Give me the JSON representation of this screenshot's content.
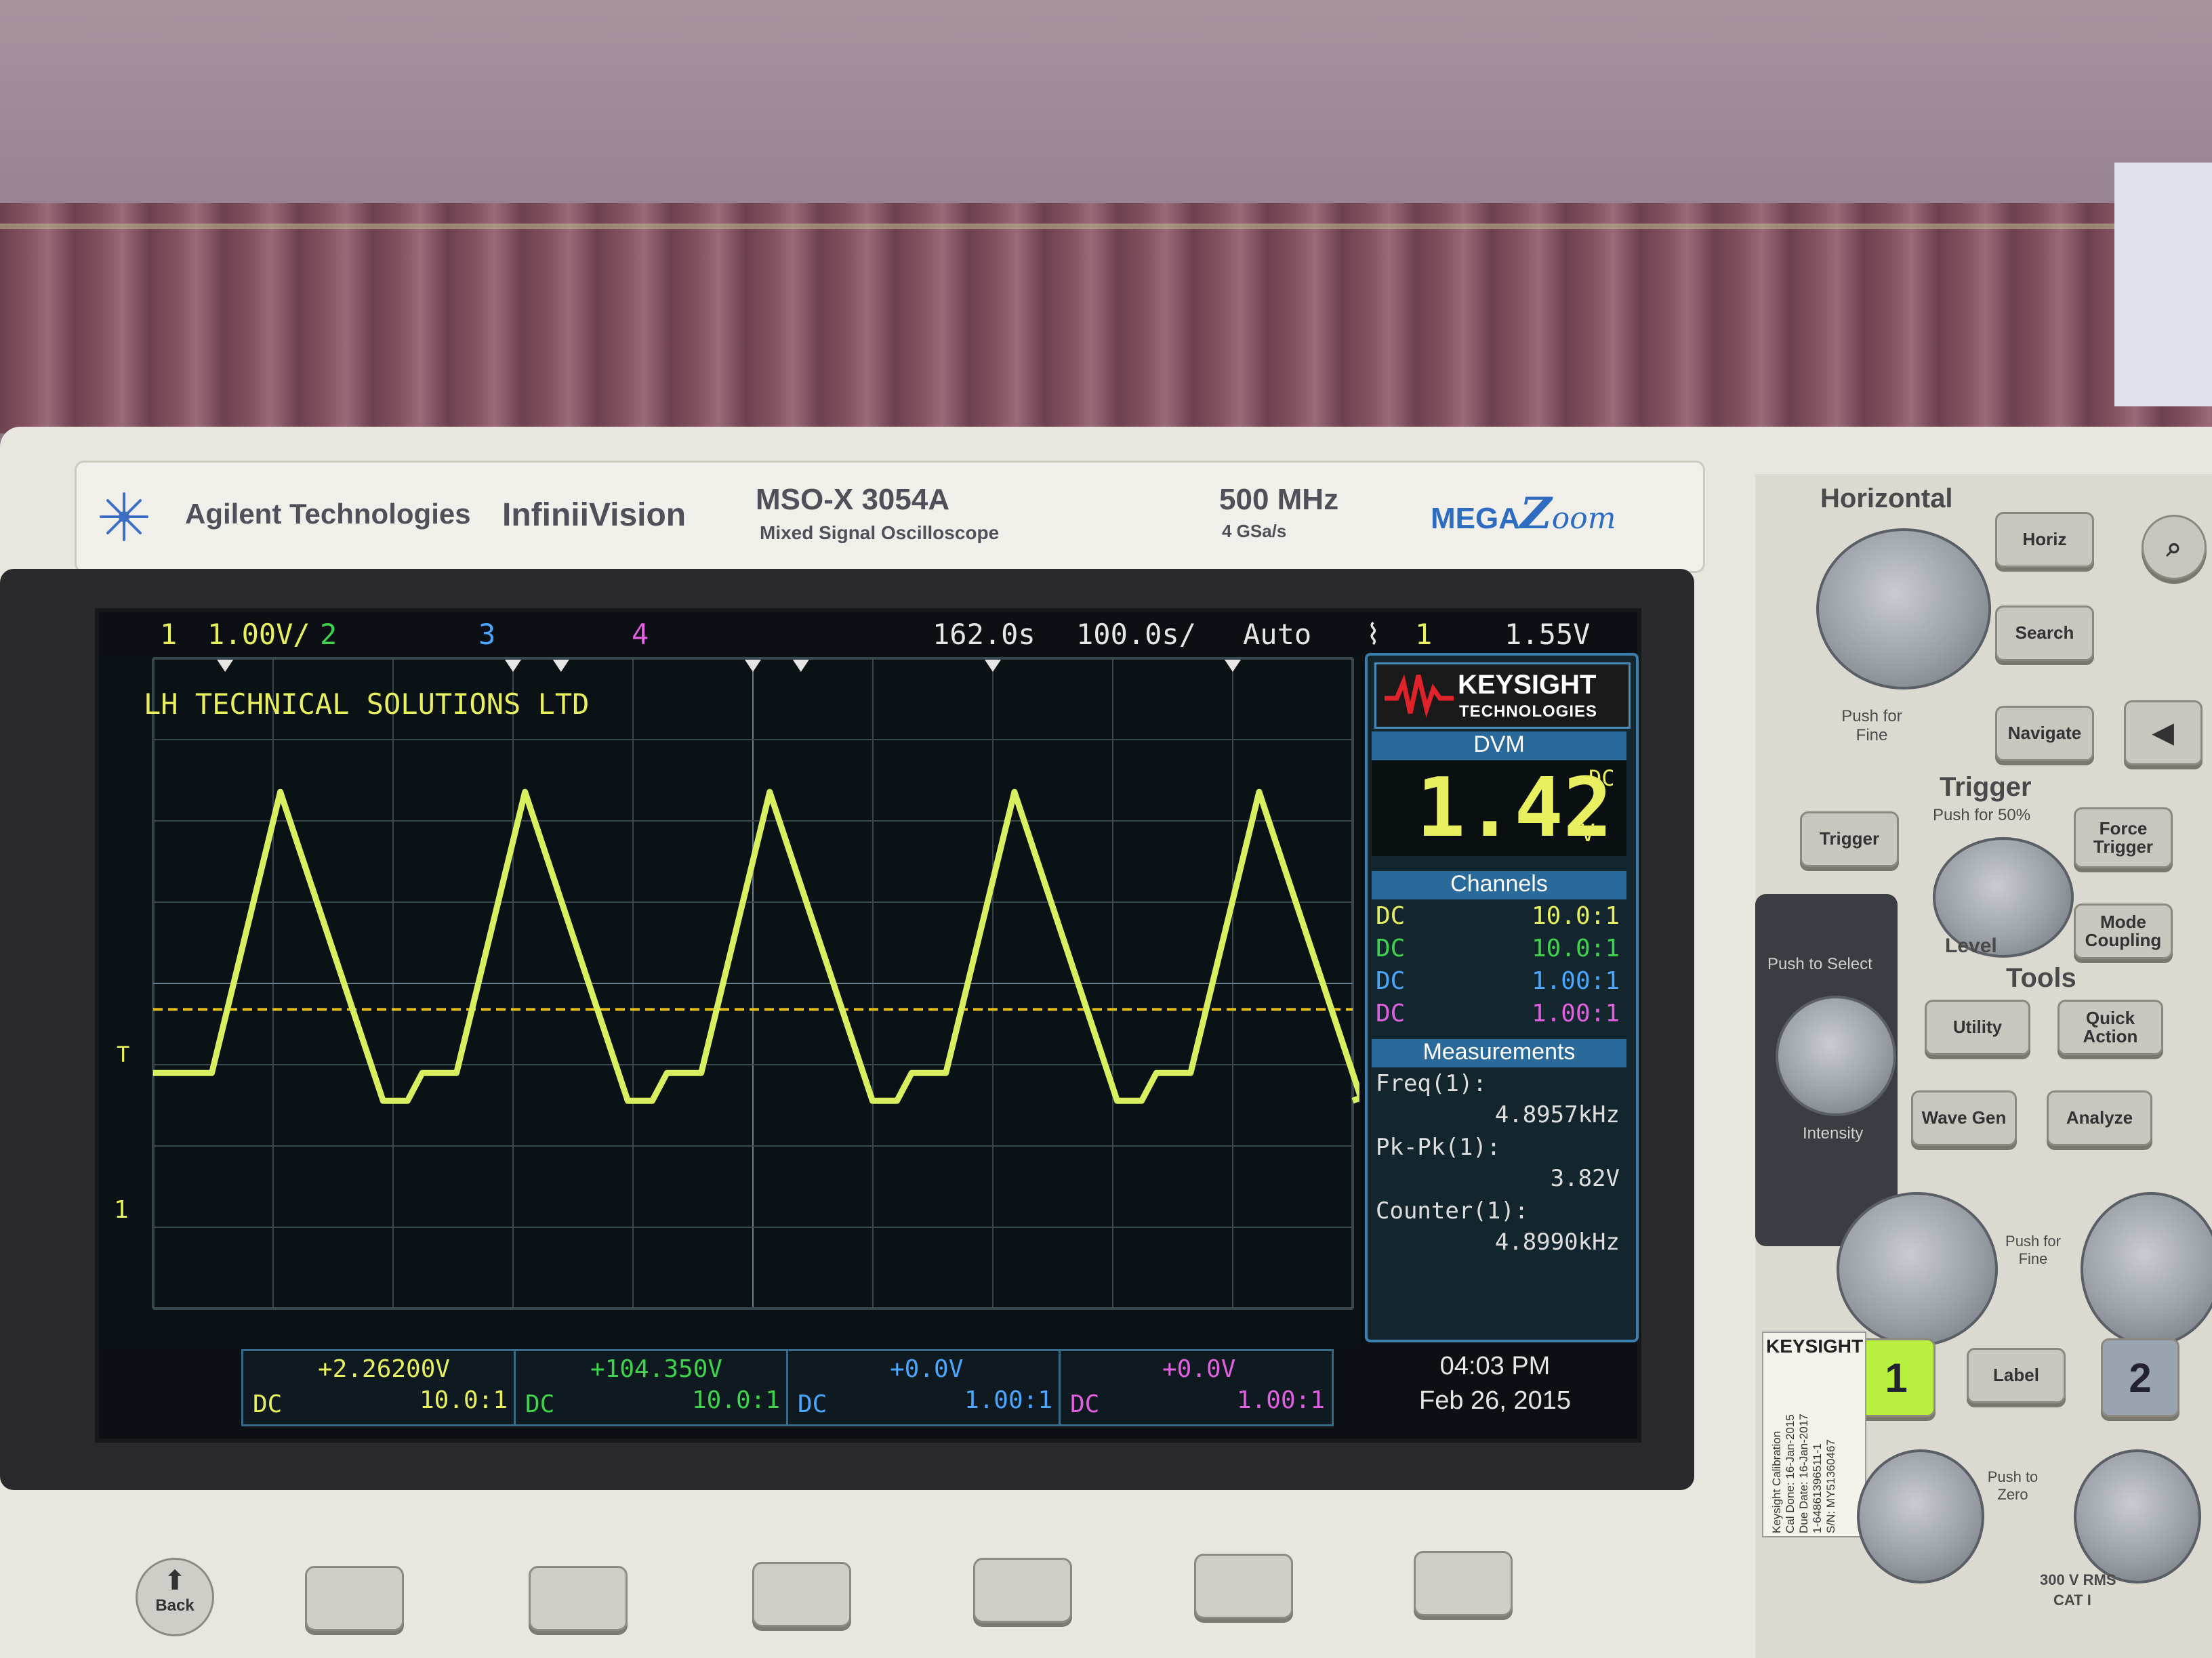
{
  "header": {
    "brand": "Agilent Technologies",
    "series": "InfiniiVision",
    "model": "MSO-X 3054A",
    "model_sub": "Mixed Signal Oscilloscope",
    "bandwidth": "500 MHz",
    "sample_rate": "4 GSa/s",
    "logo_mega": "MEGA",
    "logo_zoom": "oom"
  },
  "status_bar": {
    "ch1": "1",
    "ch1_scale": "1.00V/",
    "ch2": "2",
    "ch3": "3",
    "ch4": "4",
    "delay": "162.0s",
    "timebase": "100.0s/",
    "mode": "Auto",
    "trig_source": "1",
    "trig_level": "1.55V"
  },
  "colors": {
    "ch1": "#e8f060",
    "ch2": "#3fd24c",
    "ch3": "#4aa6ff",
    "ch4": "#e060e0",
    "panel_header": "#2a6a9a",
    "trace": "#d8f060"
  },
  "screen": {
    "annotation": "LH TECHNICAL SOLUTIONS LTD",
    "trigger_marker": "T",
    "ground_marker": "1"
  },
  "sidebar": {
    "keysight": "KEYSIGHT",
    "technologies": "TECHNOLOGIES",
    "dvm_title": "DVM",
    "dvm_value": "1.42",
    "dvm_coupling": "DC",
    "dvm_unit": "V",
    "channels_title": "Channels",
    "channels": [
      {
        "coupling": "DC",
        "probe": "10.0:1"
      },
      {
        "coupling": "DC",
        "probe": "10.0:1"
      },
      {
        "coupling": "DC",
        "probe": "1.00:1"
      },
      {
        "coupling": "DC",
        "probe": "1.00:1"
      }
    ],
    "measurements_title": "Measurements",
    "measurements": [
      {
        "label": "Freq(1):",
        "value": "4.8957kHz"
      },
      {
        "label": "Pk-Pk(1):",
        "value": "3.82V"
      },
      {
        "label": "Counter(1):",
        "value": "4.8990kHz"
      }
    ]
  },
  "footer": {
    "channels": [
      {
        "offset": "+2.26200V",
        "coupling": "DC",
        "probe": "10.0:1"
      },
      {
        "offset": "+104.350V",
        "coupling": "DC",
        "probe": "10.0:1"
      },
      {
        "offset": "+0.0V",
        "coupling": "DC",
        "probe": "1.00:1"
      },
      {
        "offset": "+0.0V",
        "coupling": "DC",
        "probe": "1.00:1"
      }
    ],
    "time": "04:03 PM",
    "date": "Feb 26, 2015"
  },
  "panel": {
    "horizontal": "Horizontal",
    "horiz": "Horiz",
    "search": "Search",
    "navigate": "Navigate",
    "push_fine": "Push for Fine",
    "trigger_title": "Trigger",
    "push_50": "Push for 50%",
    "trigger": "Trigger",
    "force_trigger": "Force Trigger",
    "level": "Level",
    "mode_coupling": "Mode Coupling",
    "push_select": "Push to Select",
    "intensity": "Intensity",
    "tools": "Tools",
    "utility": "Utility",
    "quick_action": "Quick Action",
    "wave_gen": "Wave Gen",
    "analyze": "Analyze",
    "push_fine2": "Push for Fine",
    "ch1_key": "1",
    "label": "Label",
    "ch2_key": "2",
    "push_zero": "Push to Zero",
    "keysight_sticker": "KEYSIGHT",
    "cal_lines": [
      "Keysight Calibration",
      "Cal Done: 16-Jan-2015",
      "Due Date: 16-Jan-2017",
      "1-64861396511-1",
      "S/N: MY51360467"
    ],
    "back": "Back",
    "rms": "300 V RMS",
    "cat": "CAT I"
  },
  "waveform": {
    "peaks": 5,
    "period_divisions": 2.04,
    "pk_pk_divisions": 3.8,
    "trigger_level_divisions": 1.55
  }
}
